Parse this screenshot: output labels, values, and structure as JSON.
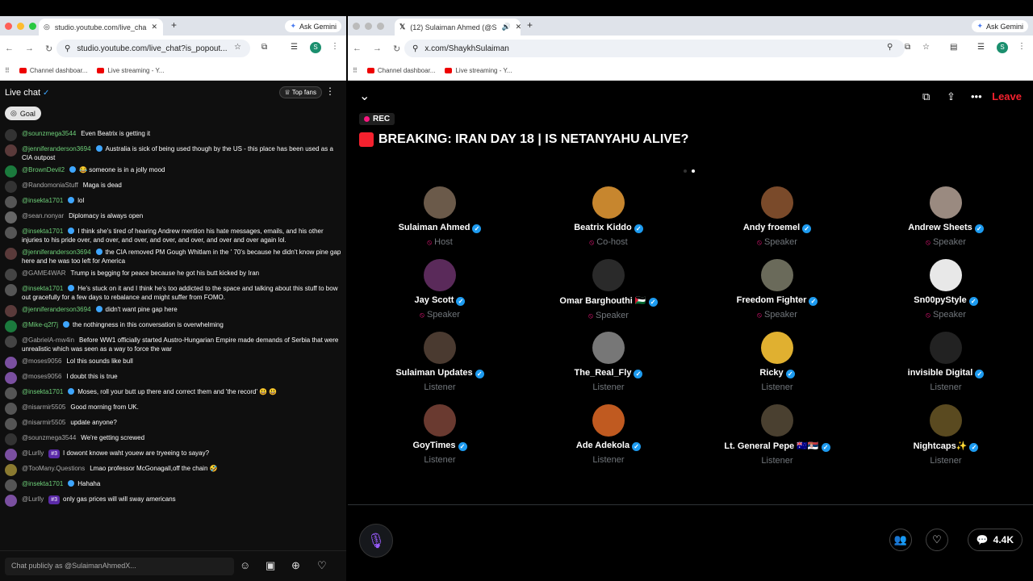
{
  "left_browser": {
    "tab_title": "studio.youtube.com/live_cha",
    "url": "studio.youtube.com/live_chat?is_popout...",
    "ask": "Ask Gemini",
    "bookmarks": [
      "Channel dashboar...",
      "Live streaming - Y..."
    ],
    "profile": "S"
  },
  "chat": {
    "title": "Live chat",
    "top_fans": "Top fans",
    "goal": "Goal",
    "input_placeholder": "Chat publicly as @SulaimanAhmedX...",
    "messages": [
      {
        "author": "@sounzmega3544",
        "text": "Even Beatrix is getting it",
        "av": "#333",
        "green": true,
        "badge": false,
        "rank": ""
      },
      {
        "author": "@jenniferanderson3694",
        "text": "Australia is sick of being used though by the US - this place has been used as a CIA outpost",
        "av": "#5a3a3a",
        "green": true,
        "badge": true,
        "rank": ""
      },
      {
        "author": "@BrownDevil2",
        "text": "😂 someone is in a jolly mood",
        "av": "#1b7a3d",
        "green": true,
        "badge": true,
        "rank": ""
      },
      {
        "author": "@RandomoniaStuff",
        "text": "Maga is dead",
        "av": "#333",
        "green": false,
        "badge": false,
        "rank": ""
      },
      {
        "author": "@insekta1701",
        "text": "lol",
        "av": "#555",
        "green": true,
        "badge": true,
        "rank": ""
      },
      {
        "author": "@sean.nonyar",
        "text": "Diplomacy is always open",
        "av": "#666",
        "green": false,
        "badge": false,
        "rank": ""
      },
      {
        "author": "@insekta1701",
        "text": "I think she's tired of hearing Andrew mention his hate messages, emails, and his other injuries to his pride over, and over, and over, and over, and over, and over and over again lol.",
        "av": "#555",
        "green": true,
        "badge": true,
        "rank": ""
      },
      {
        "author": "@jenniferanderson3694",
        "text": "the CIA removed PM Gough Whitlam in the ' 70's because he didn't know pine gap here and he was too left for America",
        "av": "#5a3a3a",
        "green": true,
        "badge": true,
        "rank": ""
      },
      {
        "author": "@GAME4WAR",
        "text": "Trump is begging for peace because he got his butt kicked by Iran",
        "av": "#444",
        "green": false,
        "badge": false,
        "rank": ""
      },
      {
        "author": "@insekta1701",
        "text": "He's stuck on it and I think he's too addicted to the space and talking about this stuff to bow out gracefully for a few days to rebalance and might suffer from FOMO.",
        "av": "#555",
        "green": true,
        "badge": true,
        "rank": ""
      },
      {
        "author": "@jenniferanderson3694",
        "text": "didn't want pine gap here",
        "av": "#5a3a3a",
        "green": true,
        "badge": true,
        "rank": ""
      },
      {
        "author": "@Mike-q2f7j",
        "text": "the nothingness in this conversation is overwhelming",
        "av": "#1b7a3d",
        "green": true,
        "badge": true,
        "rank": ""
      },
      {
        "author": "@GabrielA-mw4in",
        "text": "Before WW1 officially started Austro-Hungarian Empire made demands of Serbia that were unrealistic which was seen as a way to force the war",
        "av": "#444",
        "green": false,
        "badge": false,
        "rank": ""
      },
      {
        "author": "@moses9056",
        "text": "Lol this sounds like bull",
        "av": "#7a4fa0",
        "green": false,
        "badge": false,
        "rank": ""
      },
      {
        "author": "@moses9056",
        "text": "I doubt this is true",
        "av": "#7a4fa0",
        "green": false,
        "badge": false,
        "rank": ""
      },
      {
        "author": "@insekta1701",
        "text": "Moses, roll your butt up there and correct them and 'the record' 😃 😃",
        "av": "#555",
        "green": true,
        "badge": true,
        "rank": ""
      },
      {
        "author": "@nisarmir5505",
        "text": "Good morning from UK.",
        "av": "#555",
        "green": false,
        "badge": false,
        "rank": ""
      },
      {
        "author": "@nisarmir5505",
        "text": "update anyone?",
        "av": "#555",
        "green": false,
        "badge": false,
        "rank": ""
      },
      {
        "author": "@sounzmega3544",
        "text": "We're getting screwed",
        "av": "#333",
        "green": false,
        "badge": false,
        "rank": ""
      },
      {
        "author": "@Lurlly",
        "text": "I dowont knowe waht youew are tryeeing to sayay?",
        "av": "#7a4fa0",
        "green": false,
        "badge": false,
        "rank": "#3"
      },
      {
        "author": "@TooMany.Questions",
        "text": "Lmao professor McGonagall,off the chain 🤣",
        "av": "#8a7a30",
        "green": false,
        "badge": false,
        "rank": ""
      },
      {
        "author": "@insekta1701",
        "text": "Hahaha",
        "av": "#555",
        "green": true,
        "badge": true,
        "rank": ""
      },
      {
        "author": "@Lurlly",
        "text": "only gas prices will will sway americans",
        "av": "#7a4fa0",
        "green": false,
        "badge": false,
        "rank": "#3"
      }
    ]
  },
  "right_browser": {
    "tab_title": "(12) Sulaiman Ahmed (@S",
    "url": "x.com/ShaykhSulaiman",
    "ask": "Ask Gemini",
    "bookmarks": [
      "Channel dashboar...",
      "Live streaming - Y..."
    ],
    "profile": "S"
  },
  "space": {
    "rec": "REC",
    "title": "BREAKING: IRAN DAY 18 | IS NETANYAHU ALIVE?",
    "leave": "Leave",
    "listeners_count": "4.4K",
    "participants": [
      {
        "name": "Sulaiman Ahmed",
        "role": "Host",
        "mic": true,
        "color": "#6b5a4a"
      },
      {
        "name": "Beatrix Kiddo",
        "role": "Co-host",
        "mic": true,
        "color": "#c7862e"
      },
      {
        "name": "Andy froemel",
        "role": "Speaker",
        "mic": true,
        "color": "#7a4a2a"
      },
      {
        "name": "Andrew Sheets",
        "role": "Speaker",
        "mic": true,
        "color": "#9a8a80"
      },
      {
        "name": "Jay Scott",
        "role": "Speaker",
        "mic": true,
        "color": "#5a2a5a"
      },
      {
        "name": "Omar Barghouthi 🇵🇸",
        "role": "Speaker",
        "mic": true,
        "color": "#2a2a2a"
      },
      {
        "name": "Freedom Fighter",
        "role": "Speaker",
        "mic": true,
        "color": "#6a6a5a"
      },
      {
        "name": "Sn00pyStyle",
        "role": "Speaker",
        "mic": true,
        "color": "#e8e8e8"
      },
      {
        "name": "Sulaiman Updates",
        "role": "Listener",
        "mic": false,
        "color": "#4a3a30"
      },
      {
        "name": "The_Real_Fly",
        "role": "Listener",
        "mic": false,
        "color": "#777"
      },
      {
        "name": "Ricky",
        "role": "Listener",
        "mic": false,
        "color": "#e0b030"
      },
      {
        "name": "invisible Digital",
        "role": "Listener",
        "mic": false,
        "color": "#222"
      },
      {
        "name": "GoyTimes",
        "role": "Listener",
        "mic": false,
        "color": "#6a3a30"
      },
      {
        "name": "Ade Adekola",
        "role": "Listener",
        "mic": false,
        "color": "#c05a20"
      },
      {
        "name": "Lt. General Pepe 🇦🇺🇷🇸",
        "role": "Listener",
        "mic": false,
        "color": "#4a4030"
      },
      {
        "name": "Nightcaps✨",
        "role": "Listener",
        "mic": false,
        "color": "#5a4a20"
      }
    ]
  }
}
